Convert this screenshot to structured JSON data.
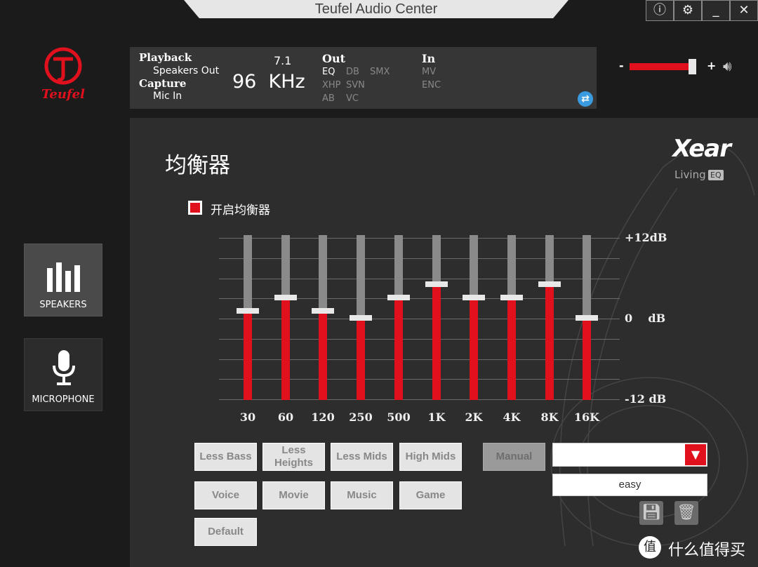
{
  "window": {
    "title": "Teufel Audio Center",
    "buttons": [
      "ⓘ",
      "⚙",
      "_",
      "✕"
    ]
  },
  "brand": {
    "logo_text": "Teufel",
    "color": "#e0101c"
  },
  "info": {
    "playback_label": "Playback",
    "playback_value": "Speakers Out",
    "capture_label": "Capture",
    "capture_value": "Mic In",
    "channels": "7.1",
    "sample_rate": "96  KHz",
    "out_label": "Out",
    "out_items": [
      "EQ",
      "DB",
      "SMX",
      "XHP",
      "SVN",
      "AB",
      "VC"
    ],
    "out_active": "EQ",
    "in_label": "In",
    "in_items": [
      "MV",
      "ENC"
    ]
  },
  "volume": {
    "minus": "-",
    "plus": "+",
    "level_percent": 92
  },
  "sidebar": {
    "items": [
      {
        "label": "SPEAKERS",
        "active": true
      },
      {
        "label": "MICROPHONE",
        "active": false
      }
    ]
  },
  "eq": {
    "title": "均衡器",
    "enable_label": "开启均衡器",
    "enabled": true,
    "xear_logo": "Xear",
    "xear_sub": "Living",
    "xear_badge": "EQ"
  },
  "chart_data": {
    "type": "bar",
    "categories": [
      "30",
      "60",
      "120",
      "250",
      "500",
      "1K",
      "2K",
      "4K",
      "8K",
      "16K"
    ],
    "values": [
      1,
      3,
      1,
      0,
      3,
      5,
      3,
      3,
      5,
      0
    ],
    "ylim": [
      -12,
      12
    ],
    "ytick_labels": [
      "+12dB",
      "0    dB",
      "-12 dB"
    ],
    "grid": true,
    "fill_color": "#e0101c"
  },
  "presets": {
    "buttons": [
      "Less Bass",
      "Less Heights",
      "Less Mids",
      "High Mids",
      "Voice",
      "Movie",
      "Music",
      "Game",
      "Default"
    ],
    "manual": "Manual",
    "dropdown_value": "",
    "name_value": "easy"
  },
  "watermark": "什么值得买"
}
